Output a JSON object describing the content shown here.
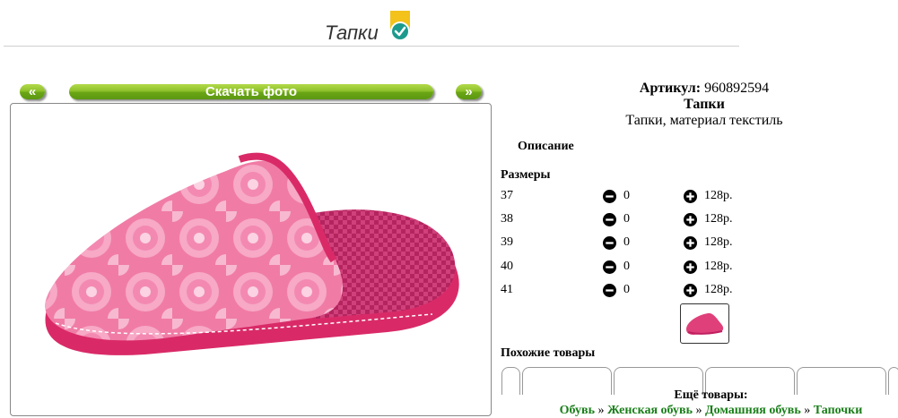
{
  "header": {
    "title": "Тапки"
  },
  "nav": {
    "prev_label": "«",
    "download_label": "Скачать фото",
    "next_label": "»"
  },
  "product": {
    "article_label": "Артикул:",
    "article_value": "960892594",
    "name": "Тапки",
    "subtitle": "Тапки, материал текстиль",
    "description_label": "Описание",
    "sizes_label": "Размеры",
    "sizes": [
      {
        "size": "37",
        "qty": "0",
        "price": "128р."
      },
      {
        "size": "38",
        "qty": "0",
        "price": "128р."
      },
      {
        "size": "39",
        "qty": "0",
        "price": "128р."
      },
      {
        "size": "40",
        "qty": "0",
        "price": "128р."
      },
      {
        "size": "41",
        "qty": "0",
        "price": "128р."
      }
    ]
  },
  "similar": {
    "label": "Похожие товары"
  },
  "more": {
    "label": "Ещё товары:",
    "sep": "»",
    "links": [
      "Обувь",
      "Женская обувь",
      "Домашняя обувь",
      "Тапочки"
    ]
  },
  "colors": {
    "accent_green": "#8ec12a",
    "link_green": "#1a7f1a",
    "slipper_pink": "#e0407a"
  }
}
